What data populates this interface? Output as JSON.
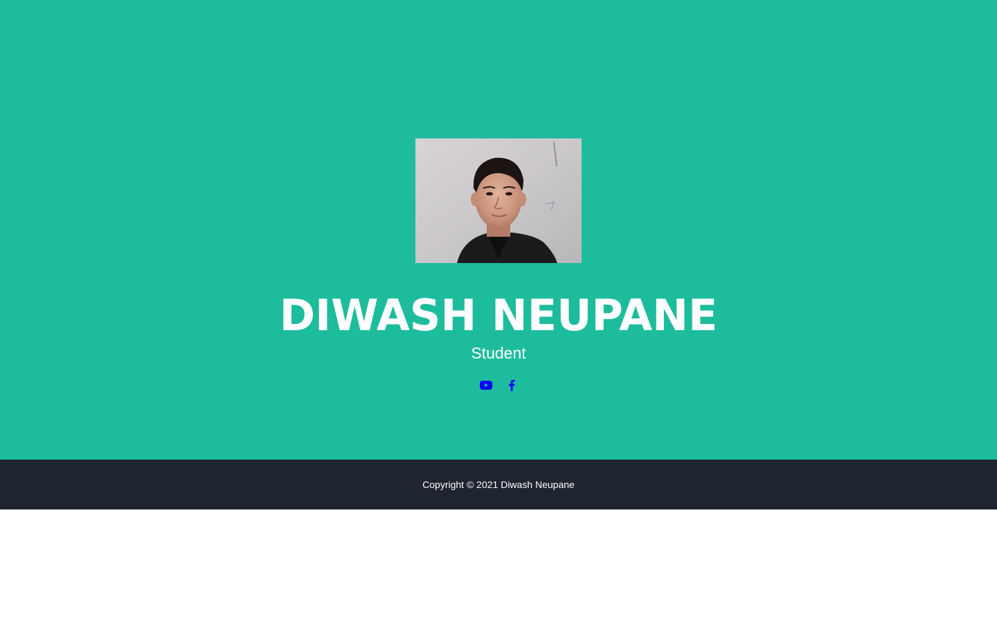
{
  "hero": {
    "name": "DIWASH NEUPANE",
    "role": "Student",
    "photo_alt": "Diwash Neupane",
    "background_color": "#1dbc9c"
  },
  "socials": [
    {
      "icon": "youtube-icon",
      "label": "YouTube",
      "color": "#0000ff"
    },
    {
      "icon": "facebook-icon",
      "label": "Facebook",
      "color": "#0000ff"
    }
  ],
  "footer": {
    "copyright": "Copyright © 2021 Diwash Neupane",
    "background_color": "#1e2530"
  }
}
